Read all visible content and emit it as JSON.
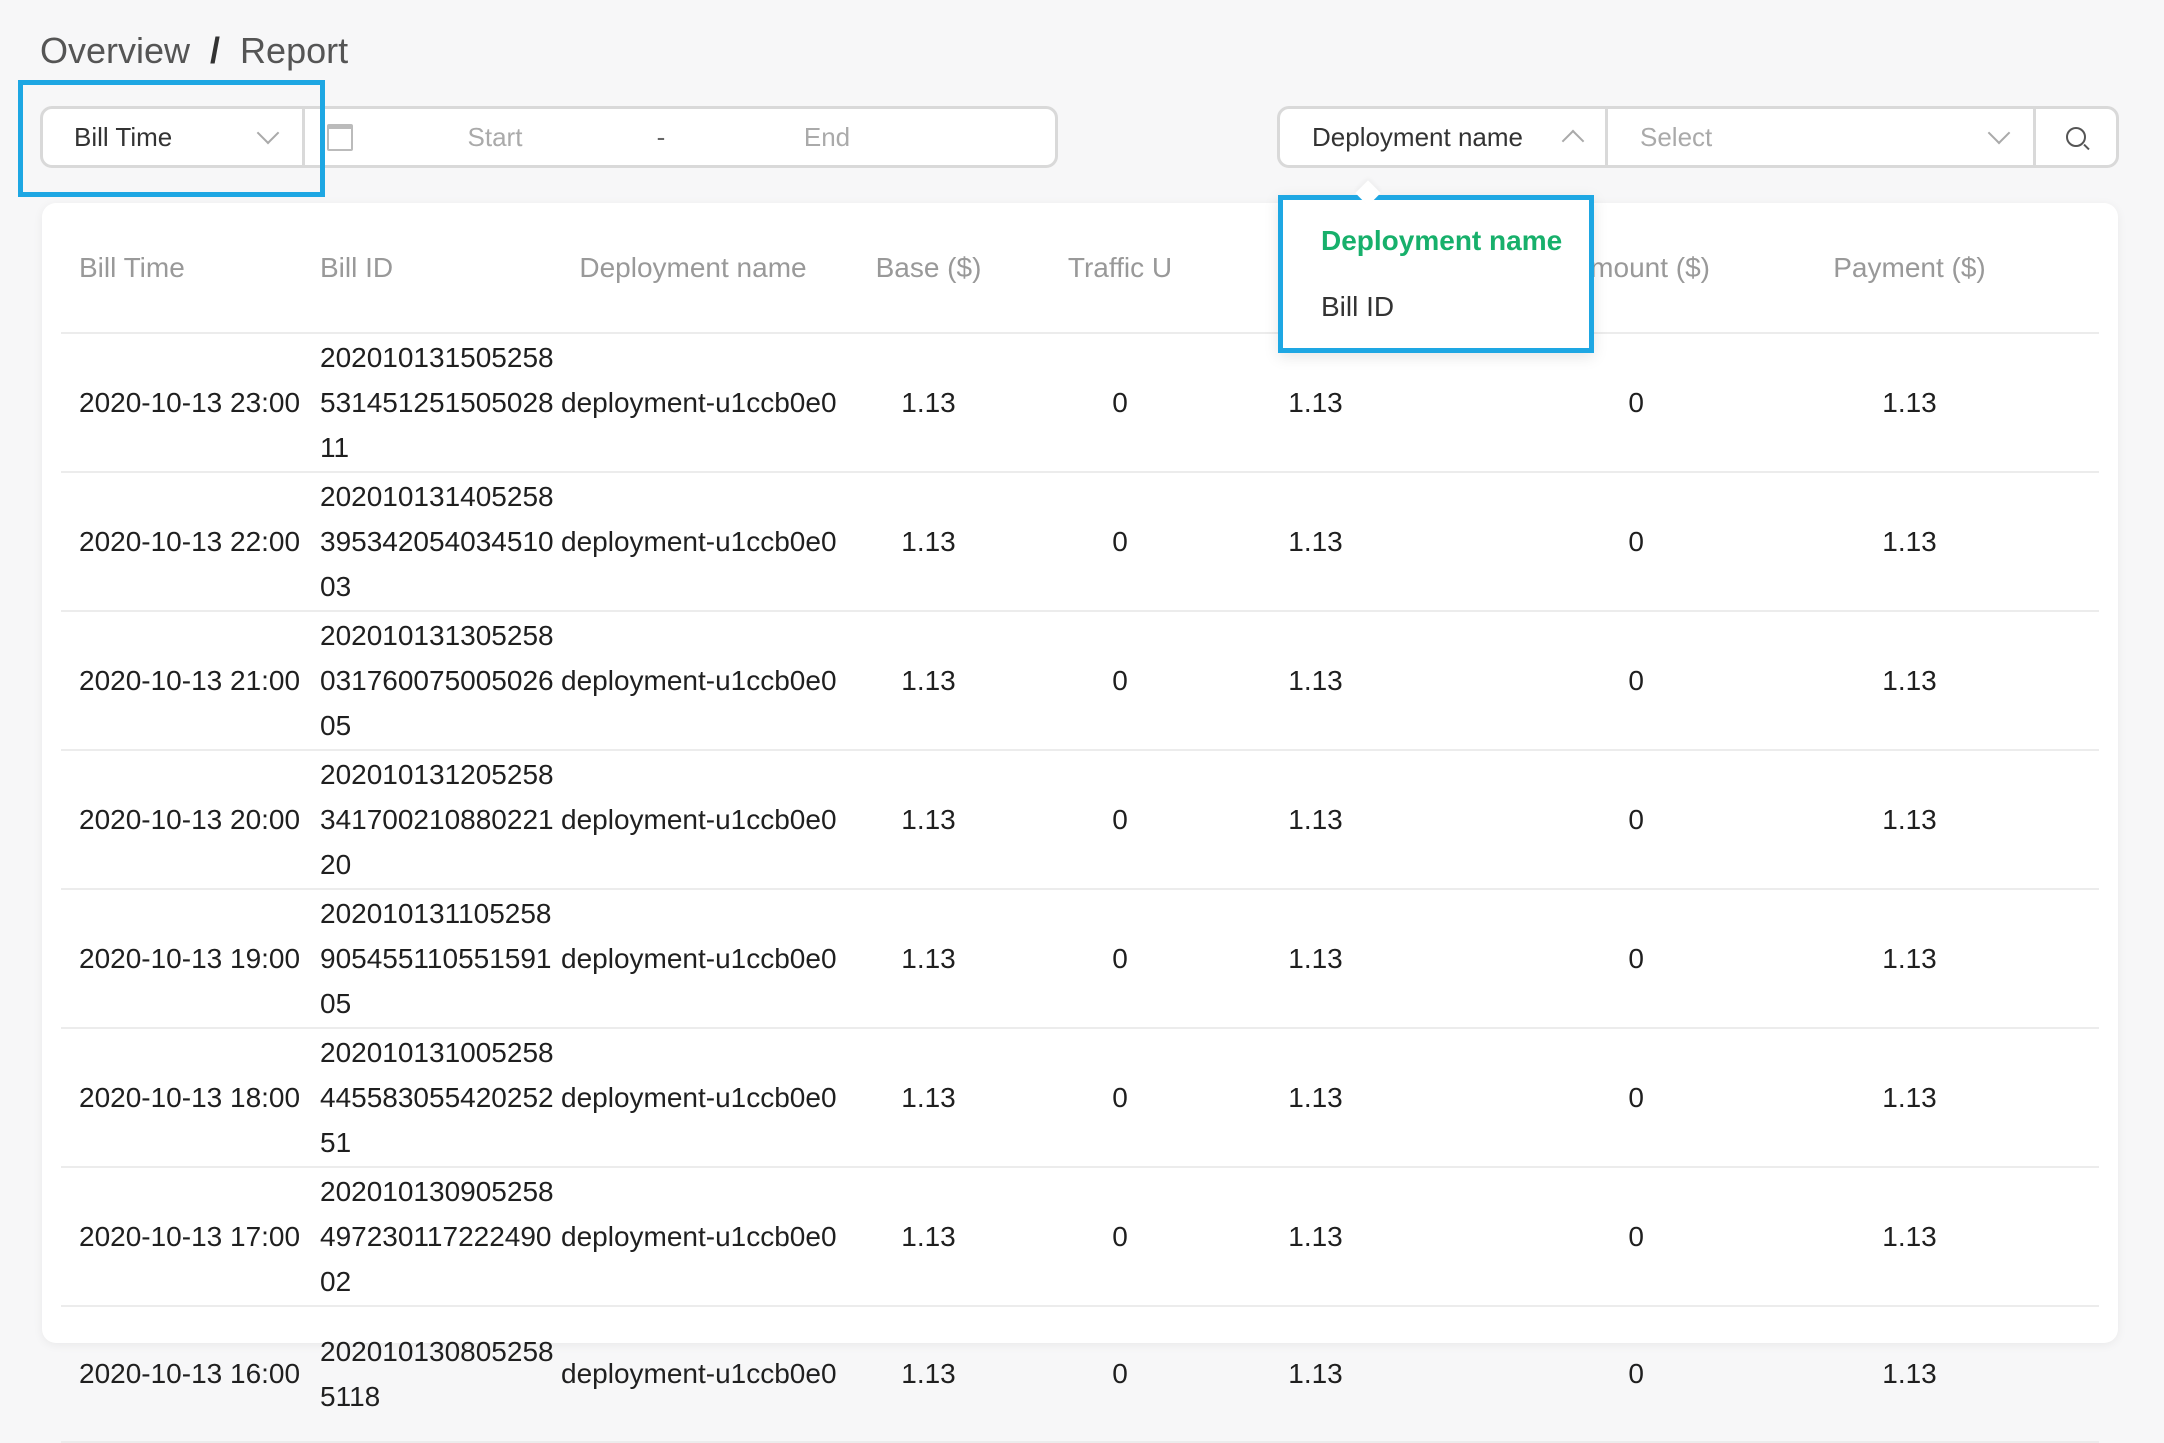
{
  "breadcrumb": {
    "parent": "Overview",
    "separator": "/",
    "current": "Report"
  },
  "filter": {
    "time_type": "Bill Time",
    "date_start_placeholder": "Start",
    "date_separator": "-",
    "date_end_placeholder": "End",
    "search_field": "Deployment name",
    "search_value_placeholder": "Select"
  },
  "dropdown": {
    "options": [
      {
        "label": "Deployment name",
        "selected": true
      },
      {
        "label": "Bill ID",
        "selected": false
      }
    ]
  },
  "colors": {
    "highlight": "#1ea7e3",
    "selected_option": "#17b06b"
  },
  "table": {
    "columns": [
      "Bill Time",
      "Bill ID",
      "Deployment name",
      "Base ($)",
      "Traffic U",
      "",
      "eduction Amount ($)",
      "Payment ($)"
    ],
    "rows": [
      [
        "2020-10-13 23:00",
        "20201013150525853145125150502811",
        "deployment-u1ccb0e0",
        "1.13",
        "0",
        "1.13",
        "0",
        "1.13"
      ],
      [
        "2020-10-13 22:00",
        "20201013140525839534205403451003",
        "deployment-u1ccb0e0",
        "1.13",
        "0",
        "1.13",
        "0",
        "1.13"
      ],
      [
        "2020-10-13 21:00",
        "20201013130525803176007500502605",
        "deployment-u1ccb0e0",
        "1.13",
        "0",
        "1.13",
        "0",
        "1.13"
      ],
      [
        "2020-10-13 20:00",
        "20201013120525834170021088022120",
        "deployment-u1ccb0e0",
        "1.13",
        "0",
        "1.13",
        "0",
        "1.13"
      ],
      [
        "2020-10-13 19:00",
        "20201013110525890545511055159105",
        "deployment-u1ccb0e0",
        "1.13",
        "0",
        "1.13",
        "0",
        "1.13"
      ],
      [
        "2020-10-13 18:00",
        "20201013100525844558305542025251",
        "deployment-u1ccb0e0",
        "1.13",
        "0",
        "1.13",
        "0",
        "1.13"
      ],
      [
        "2020-10-13 17:00",
        "20201013090525849723011722249002",
        "deployment-u1ccb0e0",
        "1.13",
        "0",
        "1.13",
        "0",
        "1.13"
      ],
      [
        "2020-10-13 16:00",
        "2020101308052585118",
        "deployment-u1ccb0e0",
        "1.13",
        "0",
        "1.13",
        "0",
        "1.13"
      ]
    ]
  }
}
